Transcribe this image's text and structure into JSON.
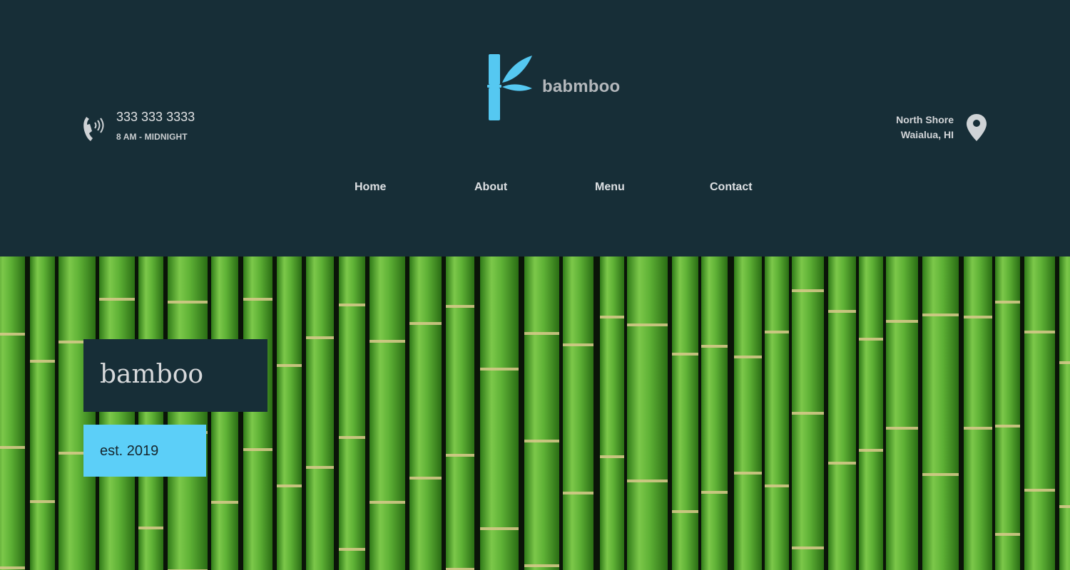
{
  "phone": {
    "number": "333 333 3333",
    "hours": "8 AM - MIDNIGHT",
    "icon": "phone-icon"
  },
  "logo": {
    "text": "babmboo",
    "icon": "bamboo-icon",
    "color": "#55c8f1"
  },
  "location": {
    "line1": "North Shore",
    "line2": "Waialua, HI",
    "icon": "map-pin-icon"
  },
  "nav": {
    "items": [
      "Home",
      "About",
      "Menu",
      "Contact"
    ]
  },
  "hero": {
    "title": "bamboo",
    "subtitle": "est. 2019"
  },
  "colors": {
    "header_bg": "#172e37",
    "accent": "#5ccff8",
    "bamboo": "#5fb236"
  }
}
